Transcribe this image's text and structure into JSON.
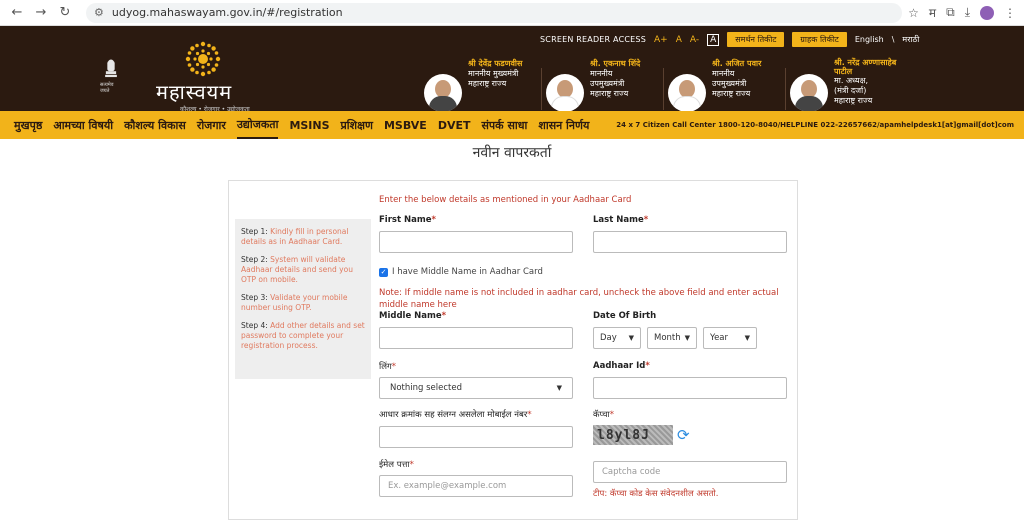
{
  "browser": {
    "url": "udyog.mahaswayam.gov.in/#/registration"
  },
  "header": {
    "brand_name": "महास्वयम",
    "brand_tagline": "कौशल्य • रोजगार • उद्योजकता",
    "emblem_caption": "सत्यमेव जयते",
    "accessibility": {
      "screen_reader": "SCREEN READER ACCESS",
      "font_large": "A+",
      "font_normal": "A",
      "font_small": "A-",
      "contrast": "A"
    },
    "support_ticket": "समर्थन तिकीट",
    "customer_ticket": "ग्राहक तिकीट",
    "lang_english": "English",
    "lang_sep": "\\",
    "lang_marathi": "मराठी",
    "leaders": [
      {
        "name": "श्री देवेंद्र फडणवीस",
        "role1": "माननीय मुख्यमंत्री",
        "role2": "महाराष्ट्र राज्य",
        "role3": ""
      },
      {
        "name": "श्री. एकनाथ शिंदे",
        "role1": "माननीय",
        "role2": "उपमुख्यमंत्री",
        "role3": "महाराष्ट्र राज्य"
      },
      {
        "name": "श्री. अजित पवार",
        "role1": "माननीय",
        "role2": "उपमुख्यमंत्री",
        "role3": "महाराष्ट्र राज्य"
      },
      {
        "name": "श्री. नरेंद्र अण्णासाहेब पाटील",
        "role1": "मा. अध्यक्ष,",
        "role2": "(मंत्री दर्जा)",
        "role3": "महाराष्ट्र राज्य"
      }
    ]
  },
  "nav": {
    "items": [
      "मुखपृष्ठ",
      "आमच्या विषयी",
      "कौशल्य विकास",
      "रोजगार",
      "उद्योजकता",
      "MSINS",
      "प्रशिक्षण",
      "MSBVE",
      "DVET",
      "संपर्क साधा",
      "शासन निर्णय"
    ],
    "helpline": "24 x 7 Citizen Call Center 1800-120-8040/HELPLINE 022-22657662/apamhelpdesk1[at]gmail[dot]com"
  },
  "page": {
    "title": "नवीन वापरकर्ता"
  },
  "steps": [
    {
      "label": "Step 1:",
      "text": "Kindly fill in personal details as in Aadhaar Card."
    },
    {
      "label": "Step 2:",
      "text": "System will validate Aadhaar details and send you OTP on mobile."
    },
    {
      "label": "Step 3:",
      "text": "Validate your mobile number using OTP."
    },
    {
      "label": "Step 4:",
      "text": "Add other details and set password to complete your registration process."
    }
  ],
  "form": {
    "intro": "Enter the below details as mentioned in your Aadhaar Card",
    "first_name_label": "First Name",
    "last_name_label": "Last Name",
    "middle_checkbox_label": "I have Middle Name in Aadhar Card",
    "note": "Note: If middle name is not included in aadhar card, uncheck the above field and enter actual middle name here",
    "middle_name_label": "Middle Name",
    "dob_label": "Date Of Birth",
    "dob_day": "Day",
    "dob_month": "Month",
    "dob_year": "Year",
    "gender_label": "लिंग",
    "gender_value": "Nothing selected",
    "aadhaar_label": "Aadhaar Id",
    "mobile_label": "आधार क्रमांक सह संलग्न असलेला मोबाईल नंबर",
    "captcha_label": "कॅप्चा",
    "captcha_text": "l8yl8J",
    "email_label": "ईमेल पत्ता",
    "email_placeholder": "Ex. example@example.com",
    "captcha_placeholder": "Captcha code",
    "captcha_tip": "टीप: कॅप्चा कोड केस संवेदनशील असतो.",
    "required_mark": "*"
  }
}
